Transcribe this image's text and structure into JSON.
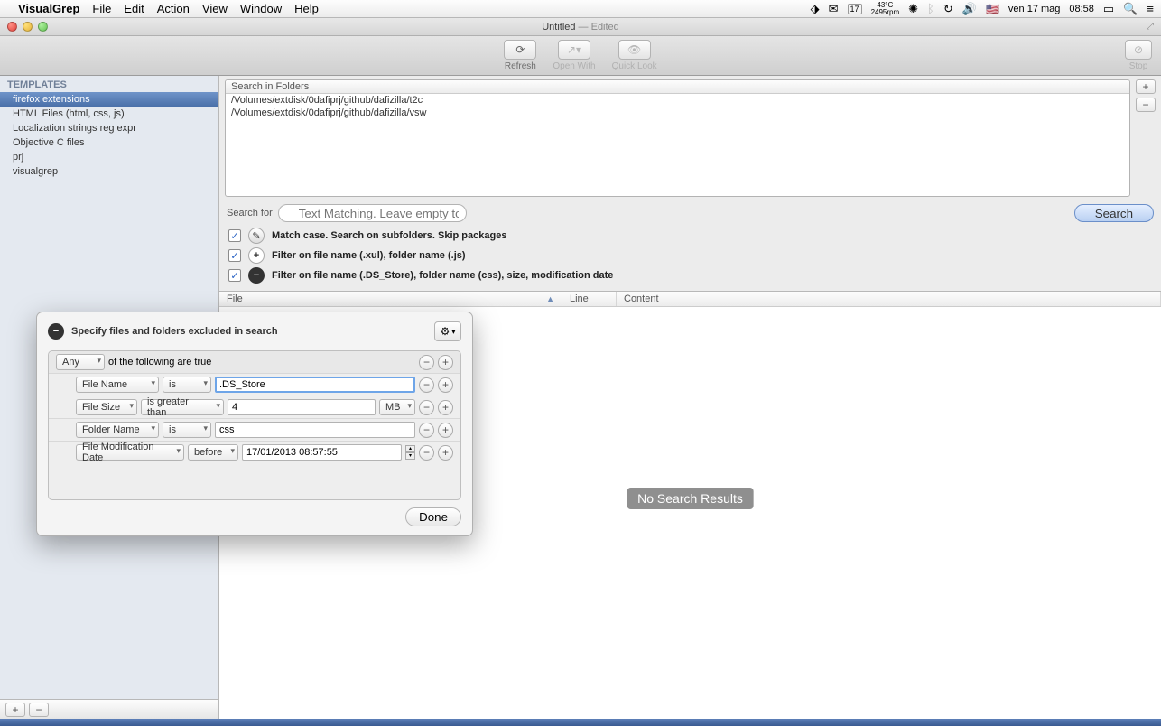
{
  "menubar": {
    "app": "VisualGrep",
    "items": [
      "File",
      "Edit",
      "Action",
      "View",
      "Window",
      "Help"
    ],
    "status": {
      "temp_top": "43°C",
      "temp_bottom": "2495rpm",
      "cal_day": "17",
      "clock_prefix": "ven 17 mag",
      "clock_time": "08:58"
    }
  },
  "window": {
    "title": "Untitled",
    "edited": " — Edited"
  },
  "toolbar": {
    "refresh": "Refresh",
    "open_with": "Open With",
    "quick_look": "Quick Look",
    "stop": "Stop"
  },
  "sidebar": {
    "header": "TEMPLATES",
    "items": [
      "firefox extensions",
      "HTML Files (html, css, js)",
      "Localization strings reg expr",
      "Objective C files",
      "prj",
      "visualgrep"
    ]
  },
  "folders": {
    "header": "Search in Folders",
    "paths": [
      "/Volumes/extdisk/0dafiprj/github/dafizilla/t2c",
      "/Volumes/extdisk/0dafiprj/github/dafizilla/vsw"
    ]
  },
  "search": {
    "label": "Search for",
    "placeholder": "Text Matching. Leave empty to match file paths by filters",
    "button": "Search"
  },
  "filters": {
    "f0": "Match case. Search on subfolders. Skip packages",
    "f1": "Filter on file name (.xul), folder name (.js)",
    "f2": "Filter on file name (.DS_Store), folder name (css), size, modification date"
  },
  "results": {
    "col_file": "File",
    "col_line": "Line",
    "col_content": "Content",
    "empty": "No Search Results"
  },
  "popover": {
    "title": "Specify files and folders excluded in search",
    "match_mode": "Any",
    "match_suffix": "of the following are true",
    "rules": {
      "r0": {
        "field": "File Name",
        "op": "is",
        "val": ".DS_Store"
      },
      "r1": {
        "field": "File Size",
        "op": "is greater than",
        "val": "4",
        "unit": "MB"
      },
      "r2": {
        "field": "Folder Name",
        "op": "is",
        "val": "css"
      },
      "r3": {
        "field": "File Modification Date",
        "op": "before",
        "val": "17/01/2013 08:57:55"
      }
    },
    "done": "Done"
  }
}
